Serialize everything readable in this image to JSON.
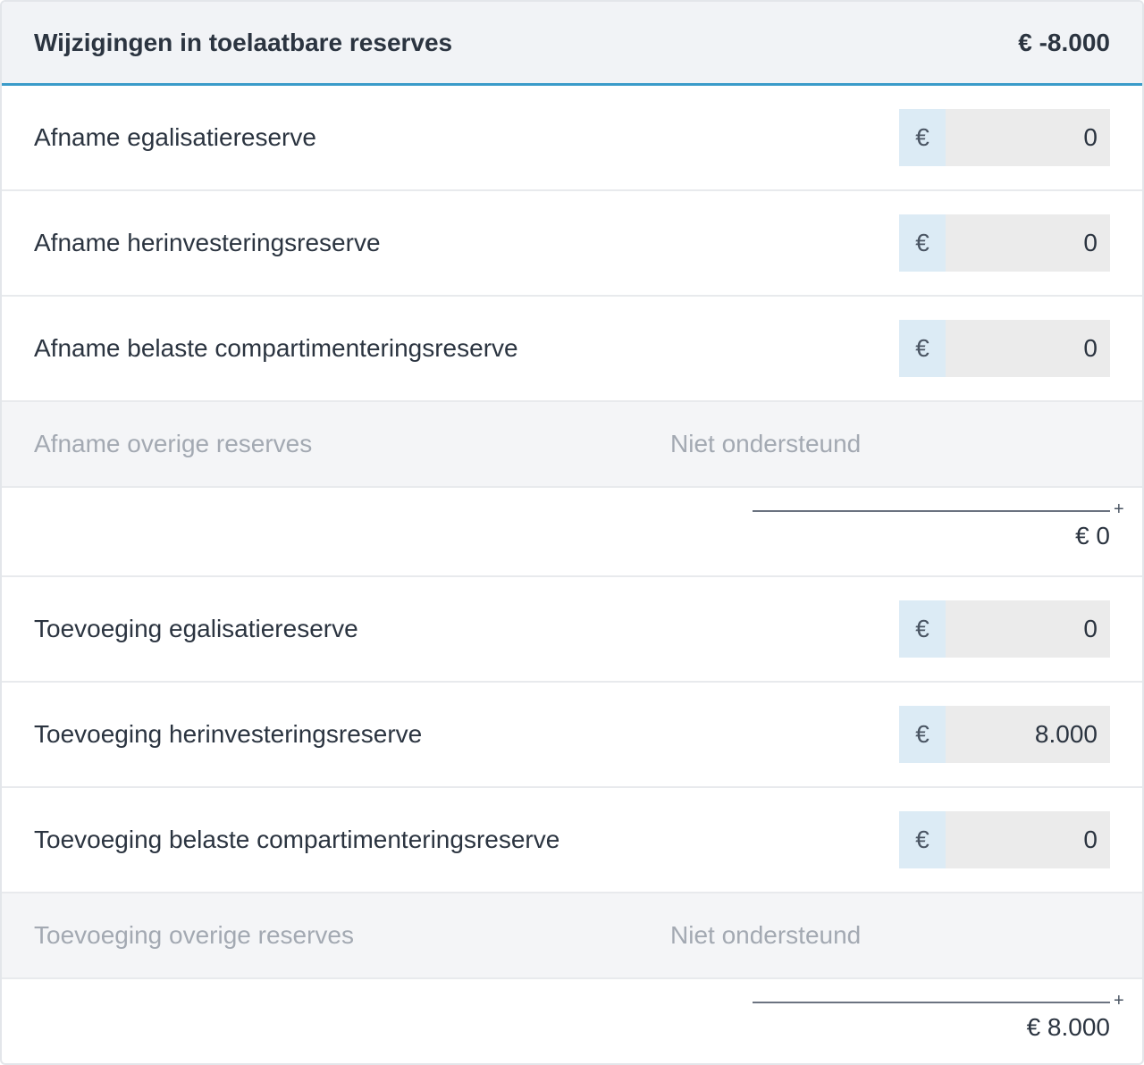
{
  "header": {
    "title": "Wijzigingen in toelaatbare reserves",
    "total": "€ -8.000"
  },
  "currency_symbol": "€",
  "afname": {
    "rows": [
      {
        "label": "Afname egalisatiereserve",
        "value": "0"
      },
      {
        "label": "Afname herinvesteringsreserve",
        "value": "0"
      },
      {
        "label": "Afname belaste compartimenteringsreserve",
        "value": "0"
      }
    ],
    "unsupported": {
      "label": "Afname overige reserves",
      "note": "Niet ondersteund"
    },
    "operator": "+",
    "subtotal": "€ 0"
  },
  "toevoeging": {
    "rows": [
      {
        "label": "Toevoeging egalisatiereserve",
        "value": "0"
      },
      {
        "label": "Toevoeging herinvesteringsreserve",
        "value": "8.000"
      },
      {
        "label": "Toevoeging belaste compartimenteringsreserve",
        "value": "0"
      }
    ],
    "unsupported": {
      "label": "Toevoeging overige reserves",
      "note": "Niet ondersteund"
    },
    "operator": "+",
    "subtotal": "€ 8.000"
  },
  "colors": {
    "accent": "#3a9bc9",
    "currency_bg": "#dcebf5",
    "input_bg": "#ebebeb",
    "muted_text": "#a3a9b2"
  }
}
